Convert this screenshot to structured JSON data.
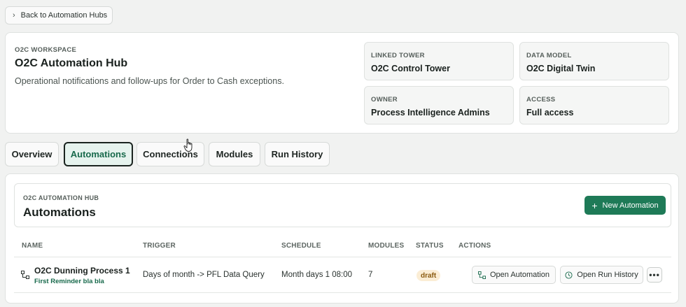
{
  "back_button": {
    "label": "Back to Automation Hubs",
    "icon": "chevron-left-icon"
  },
  "workspace": {
    "eyebrow": "O2C WORKSPACE",
    "title": "O2C Automation Hub",
    "description": "Operational notifications and follow-ups for Order to Cash exceptions."
  },
  "info": [
    {
      "label": "LINKED TOWER",
      "value": "O2C Control Tower"
    },
    {
      "label": "DATA MODEL",
      "value": "O2C Digital Twin"
    },
    {
      "label": "OWNER",
      "value": "Process Intelligence Admins"
    },
    {
      "label": "ACCESS",
      "value": "Full access"
    }
  ],
  "tabs": [
    {
      "label": "Overview",
      "active": false
    },
    {
      "label": "Automations",
      "active": true
    },
    {
      "label": "Connections",
      "active": false
    },
    {
      "label": "Modules",
      "active": false
    },
    {
      "label": "Run History",
      "active": false
    }
  ],
  "automations": {
    "eyebrow": "O2C AUTOMATION HUB",
    "title": "Automations",
    "new_button": "New Automation",
    "columns": [
      "NAME",
      "TRIGGER",
      "SCHEDULE",
      "MODULES",
      "STATUS",
      "ACTIONS"
    ],
    "rows": [
      {
        "name": "O2C Dunning Process 1",
        "subtitle": "First Reminder bla bla",
        "trigger": "Days of month -> PFL Data Query",
        "schedule": "Month days 1 08:00",
        "modules": "7",
        "status": "draft",
        "open_label": "Open Automation",
        "history_label": "Open Run History",
        "more_label": "•••"
      }
    ]
  },
  "colors": {
    "accent": "#1e7a57",
    "accent_text": "#17694b",
    "active_tab_bg": "#e6f3ee",
    "draft_bg": "#fbedd5",
    "draft_text": "#8a5a10",
    "page_bg": "#f1f2f1"
  }
}
